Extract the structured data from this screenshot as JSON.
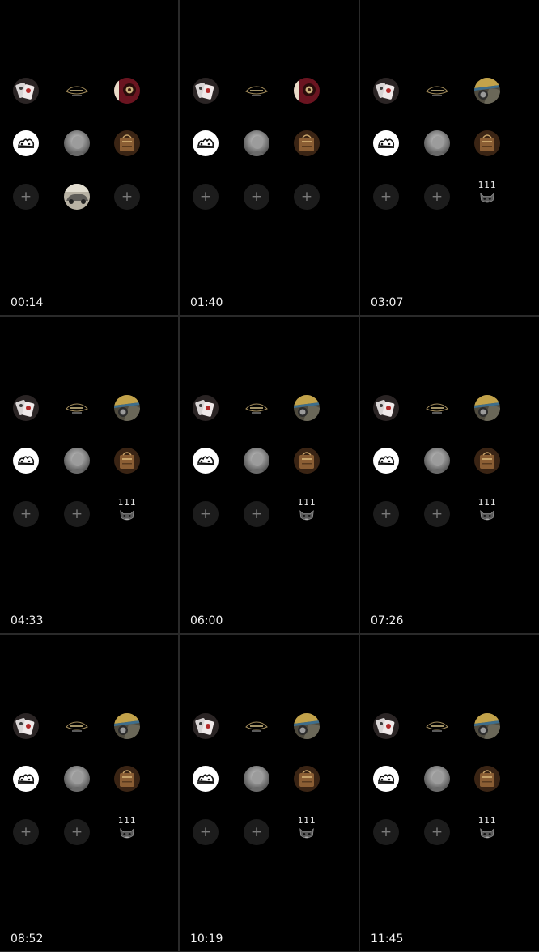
{
  "panels": [
    {
      "timestamp": "00:14",
      "icons": [
        "cards-avatar",
        "car-logo-icon",
        "red-speaker-avatar",
        "white-badge-avatar",
        "grey-portrait-avatar",
        "brown-bag-avatar",
        "plus-button",
        "silver-car-avatar",
        "plus-button"
      ]
    },
    {
      "timestamp": "01:40",
      "icons": [
        "cards-avatar",
        "car-logo-icon",
        "red-speaker-avatar",
        "white-badge-avatar",
        "grey-portrait-avatar",
        "brown-bag-avatar",
        "plus-button",
        "plus-button",
        "plus-button"
      ]
    },
    {
      "timestamp": "03:07",
      "icons": [
        "cards-avatar",
        "car-logo-icon",
        "green-car-avatar",
        "white-badge-avatar",
        "grey-portrait-avatar",
        "brown-bag-avatar",
        "plus-button",
        "plus-button",
        "number-badge-111"
      ]
    },
    {
      "timestamp": "04:33",
      "icons": [
        "cards-avatar",
        "car-logo-icon",
        "green-car-avatar",
        "white-badge-avatar",
        "grey-portrait-avatar",
        "brown-bag-avatar",
        "plus-button",
        "plus-button",
        "number-badge-111"
      ]
    },
    {
      "timestamp": "06:00",
      "icons": [
        "cards-avatar",
        "car-logo-icon",
        "green-car-avatar",
        "white-badge-avatar",
        "grey-portrait-avatar",
        "brown-bag-avatar",
        "plus-button",
        "plus-button",
        "number-badge-111"
      ]
    },
    {
      "timestamp": "07:26",
      "icons": [
        "cards-avatar",
        "car-logo-icon",
        "green-car-avatar",
        "white-badge-avatar",
        "grey-portrait-avatar",
        "brown-bag-avatar",
        "plus-button",
        "plus-button",
        "number-badge-111"
      ]
    },
    {
      "timestamp": "08:52",
      "icons": [
        "cards-avatar",
        "car-logo-icon",
        "green-car-avatar",
        "white-badge-avatar",
        "grey-portrait-avatar",
        "brown-bag-avatar",
        "plus-button",
        "plus-button",
        "number-badge-111"
      ]
    },
    {
      "timestamp": "10:19",
      "icons": [
        "cards-avatar",
        "car-logo-icon",
        "green-car-avatar",
        "white-badge-avatar",
        "grey-portrait-avatar",
        "brown-bag-avatar",
        "plus-button",
        "plus-button",
        "number-badge-111"
      ]
    },
    {
      "timestamp": "11:45",
      "icons": [
        "cards-avatar",
        "car-logo-icon",
        "green-car-avatar",
        "white-badge-avatar",
        "grey-portrait-avatar",
        "brown-bag-avatar",
        "plus-button",
        "plus-button",
        "number-badge-111"
      ]
    }
  ],
  "plus_label": "+",
  "number_badge_label": "111",
  "colors": {
    "background": "#000000",
    "divider": "#2a2a2a",
    "plus_circle": "#1c1c1c",
    "plus_glyph": "#7a7a7a",
    "timestamp": "#f2f2f2"
  }
}
